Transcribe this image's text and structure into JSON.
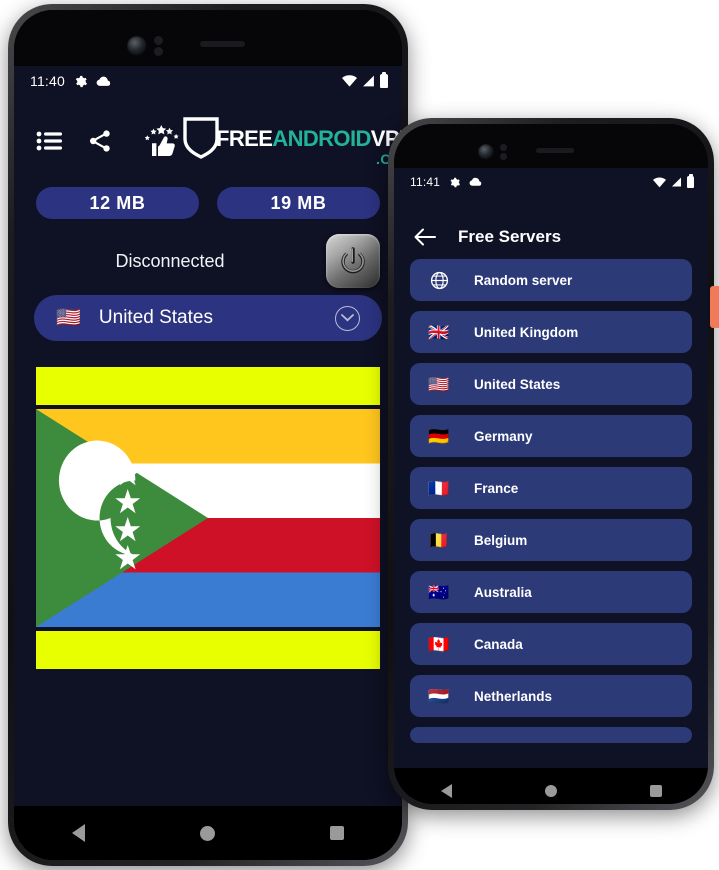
{
  "left_phone": {
    "statusbar": {
      "time": "11:40",
      "icons": [
        "gear-icon",
        "cloud-icon",
        "wifi-icon",
        "signal-icon",
        "battery-icon"
      ]
    },
    "topbar": {
      "icons": [
        {
          "name": "list-icon",
          "label": "Servers list"
        },
        {
          "name": "share-icon",
          "label": "Share"
        },
        {
          "name": "rate-thumbs-up-icon",
          "label": "Rate us"
        }
      ],
      "brand": {
        "part1": "FREE",
        "part2": "ANDROID",
        "part3": "VPN",
        "part4": ".COM",
        "color_white": "#ffffff",
        "color_teal": "#21b39b"
      }
    },
    "speed": {
      "download": "12 MB",
      "upload": "19 MB"
    },
    "connection": {
      "status": "Disconnected",
      "power_button": "power-toggle"
    },
    "server_selector": {
      "flag": "🇺🇸",
      "name": "United States",
      "chevron": "chevron-down-icon"
    },
    "ads": {
      "top_banner": "ad-banner",
      "bottom_banner": "ad-banner",
      "flag_image": "comoros-flag"
    },
    "navbar": [
      "back-button",
      "home-button",
      "recents-button"
    ]
  },
  "right_phone": {
    "statusbar": {
      "time": "11:41",
      "icons": [
        "gear-icon",
        "cloud-icon",
        "wifi-icon",
        "signal-icon",
        "battery-icon"
      ]
    },
    "appbar": {
      "back": "back-arrow-icon",
      "title": "Free Servers"
    },
    "servers": [
      {
        "flag": "globe-icon",
        "name": "Random server"
      },
      {
        "flag": "🇬🇧",
        "name": "United Kingdom"
      },
      {
        "flag": "🇺🇸",
        "name": "United States"
      },
      {
        "flag": "🇩🇪",
        "name": "Germany"
      },
      {
        "flag": "🇫🇷",
        "name": "France"
      },
      {
        "flag": "🇧🇪",
        "name": "Belgium"
      },
      {
        "flag": "🇦🇺",
        "name": "Australia"
      },
      {
        "flag": "🇨🇦",
        "name": "Canada"
      },
      {
        "flag": "🇳🇱",
        "name": "Netherlands"
      }
    ],
    "navbar": [
      "back-button",
      "home-button",
      "recents-button"
    ]
  },
  "colors": {
    "screen_bg": "#0f1124",
    "pill_blue": "#2c3380",
    "list_blue": "#2c3a78",
    "ad_yellow": "#e8ff00",
    "accent_teal": "#21b39b",
    "edge_tab": "#f07a5a"
  }
}
